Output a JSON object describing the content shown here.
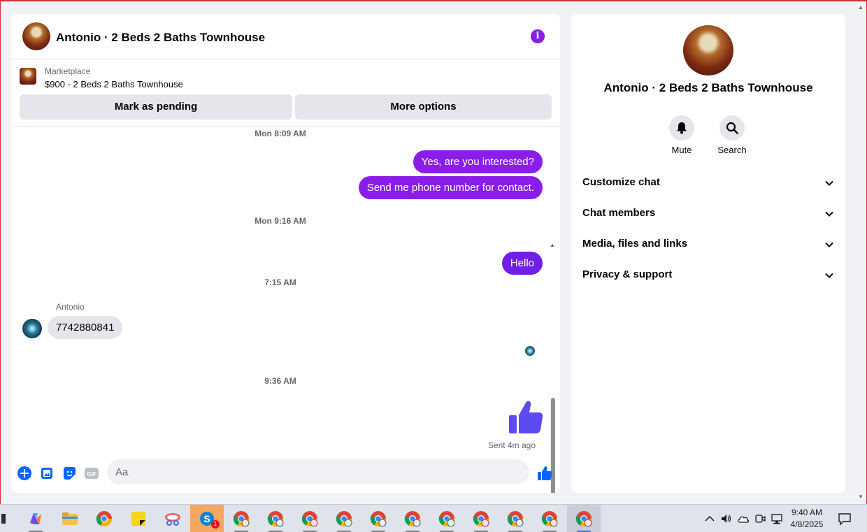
{
  "chat": {
    "title": "Antonio · 2 Beds 2 Baths Townhouse",
    "marketplace_label": "Marketplace",
    "listing": "$900 - 2 Beds 2 Baths Townhouse",
    "buttons": {
      "pending": "Mark as pending",
      "more": "More options"
    },
    "timestamps": [
      "Mon 8:09 AM",
      "Mon 9:16 AM",
      "7:15 AM",
      "9:36 AM"
    ],
    "outgoing": [
      "Yes, are you interested?",
      "Send me phone number for contact.",
      "Hello"
    ],
    "sender": "Antonio",
    "incoming": "7742880841",
    "sent_status": "Sent 4m ago",
    "composer": {
      "placeholder": "Aa",
      "gif_label": "GIF"
    }
  },
  "side": {
    "title": "Antonio · 2 Beds 2 Baths Townhouse",
    "mute": "Mute",
    "search": "Search",
    "sections": [
      "Customize chat",
      "Chat members",
      "Media, files and links",
      "Privacy & support"
    ]
  },
  "taskbar": {
    "apps": [
      "copilot-icon",
      "file-explorer-icon",
      "chrome-icon",
      "sticky-notes-icon",
      "snipping-tool-icon",
      "skype-icon",
      "chrome-profile-icon"
    ],
    "skype_badge": "1",
    "time": "9:40 AM",
    "date": "4/8/2025"
  },
  "colors": {
    "accent": "#8a1ee8",
    "like": "#5b4bf0",
    "composer_blue": "#0866ff"
  }
}
